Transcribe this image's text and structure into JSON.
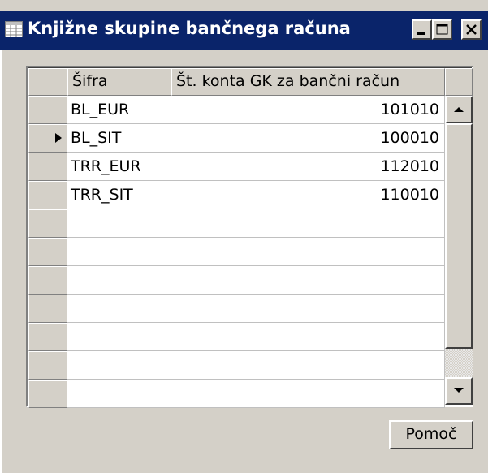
{
  "window": {
    "title": "Knjižne skupine bančnega računa",
    "icon": "table-form-icon",
    "controls": [
      "minimize-icon",
      "maximize-icon",
      "close-icon"
    ]
  },
  "table": {
    "columns": [
      "Šifra",
      "Št. konta GK za bančni račun"
    ],
    "rows": [
      {
        "code": "BL_EUR",
        "account": "101010",
        "selected": false
      },
      {
        "code": "BL_SIT",
        "account": "100010",
        "selected": true
      },
      {
        "code": "TRR_EUR",
        "account": "112010",
        "selected": false
      },
      {
        "code": "TRR_SIT",
        "account": "110010",
        "selected": false
      }
    ],
    "empty_rows": 7,
    "current_row_indicator": "triangle-right-icon"
  },
  "buttons": {
    "help_label": "Pomoč"
  },
  "colors": {
    "titlebar": "#0a246a",
    "face": "#d4d0c8"
  }
}
